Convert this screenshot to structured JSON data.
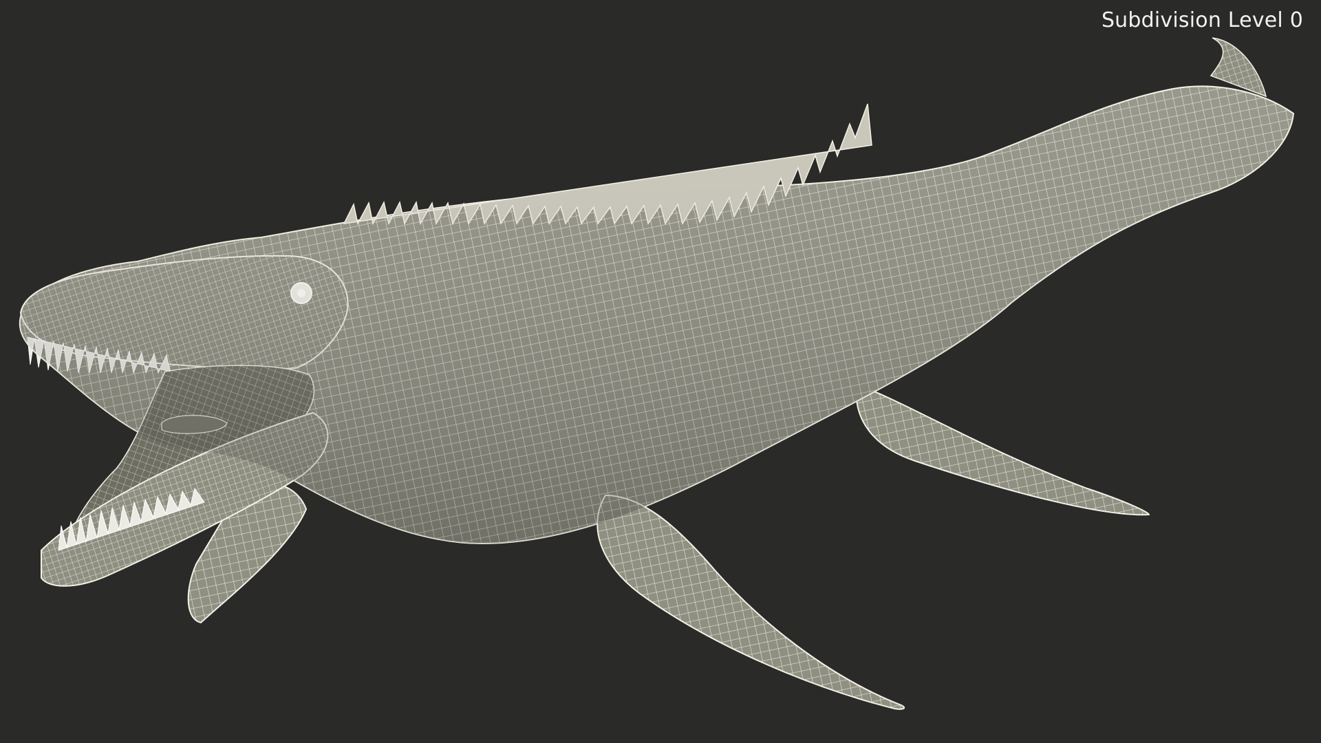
{
  "viewport": {
    "label": "Subdivision Level 0",
    "background_color": "#2a2a28"
  },
  "model": {
    "mesh_fill_color": "#8f8f82",
    "wire_color": "#f4f1e6",
    "mouth_interior_color": "#6e6e63"
  }
}
